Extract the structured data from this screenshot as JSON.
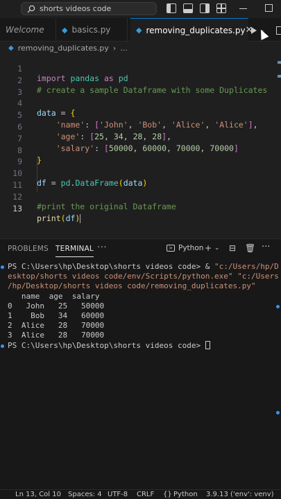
{
  "titlebar": {
    "search_text": "shorts videos code"
  },
  "tabs": [
    {
      "label": "Welcome"
    },
    {
      "label": "basics.py"
    },
    {
      "label": "removing_duplicates.py",
      "close": "✕"
    }
  ],
  "breadcrumb": {
    "file": "removing_duplicates.py",
    "more": "..."
  },
  "editor": {
    "line_numbers": [
      "1",
      "2",
      "3",
      "4",
      "5",
      "6",
      "7",
      "8",
      "9",
      "10",
      "11",
      "12",
      "13"
    ],
    "current_line": "13"
  },
  "panel": {
    "tabs": [
      "PROBLEMS",
      "TERMINAL",
      "···"
    ],
    "shell": "Python"
  },
  "terminal": {
    "prompt": "PS C:\\Users\\hp\\Desktop\\shorts videos code> ",
    "command_prefix": "& ",
    "command_line1": "\"c:/Users/hp/D",
    "command_line2": "esktop/shorts videos code/env/Scripts/python.exe\" \"c:/Users",
    "command_line3": "/hp/Desktop/shorts videos code/removing_duplicates.py\"",
    "output": [
      "   name  age  salary",
      "0   John   25   50000",
      "1    Bob   34   60000",
      "2  Alice   28   70000",
      "3  Alice   28   70000"
    ],
    "prompt2": "PS C:\\Users\\hp\\Desktop\\shorts videos code> "
  },
  "statusbar": {
    "position": "Ln 13, Col 10",
    "spaces": "Spaces: 4",
    "encoding": "UTF-8",
    "eol": "CRLF",
    "language": "Python",
    "interpreter": "3.9.13 ('env': venv)"
  },
  "colors": {
    "keyword": "#c586c0",
    "comment": "#6a9955",
    "string": "#ce9178",
    "number": "#b5cea8",
    "accent": "#0078d4"
  },
  "icons": [
    "search-icon",
    "layout-sidebar-icon",
    "layout-panel-icon",
    "layout-secondary-icon",
    "layout-grid-icon",
    "minimize-icon",
    "maximize-icon",
    "python-file-icon",
    "close-icon",
    "run-icon",
    "split-editor-icon",
    "terminal-icon",
    "add-terminal-icon",
    "split-terminal-icon",
    "trash-icon",
    "more-icon"
  ]
}
